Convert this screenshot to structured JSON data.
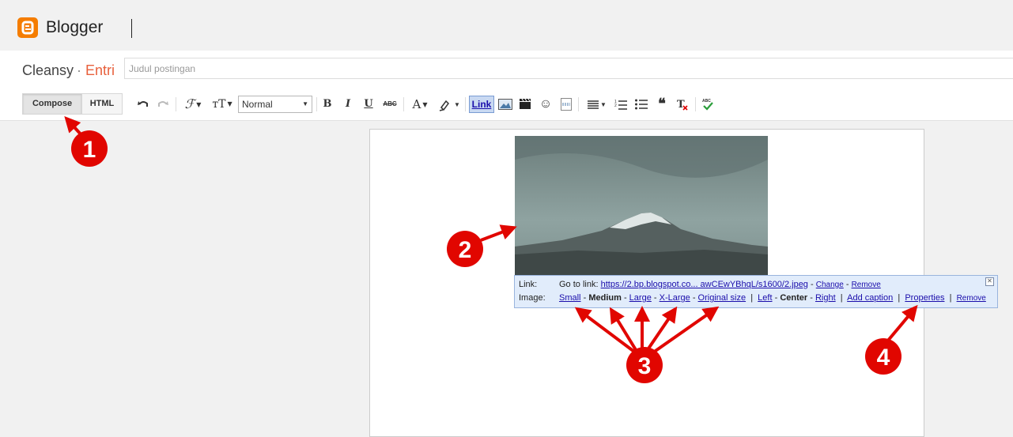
{
  "app": {
    "brand": "Blogger"
  },
  "post": {
    "blog_name": "Cleansy",
    "separator": "·",
    "section": "Entri",
    "title_placeholder": "Judul postingan"
  },
  "toolbar": {
    "compose_label": "Compose",
    "html_label": "HTML",
    "format_value": "Normal",
    "link_label": "Link"
  },
  "image_bubble": {
    "link_label": "Link:",
    "go_to_link": "Go to link:",
    "url": "https://2.bp.blogspot.co... awCEwYBhqL/s1600/2.jpeg",
    "change": "Change",
    "remove": "Remove",
    "image_label": "Image:",
    "sizes": {
      "small": "Small",
      "medium": "Medium",
      "large": "Large",
      "xlarge": "X-Large",
      "original": "Original size"
    },
    "align": {
      "left": "Left",
      "center": "Center",
      "right": "Right"
    },
    "add_caption": "Add caption",
    "properties": "Properties",
    "remove_image": "Remove"
  },
  "annotations": {
    "badge1": "1",
    "badge2": "2",
    "badge3": "3",
    "badge4": "4",
    "color": "#e10600"
  }
}
